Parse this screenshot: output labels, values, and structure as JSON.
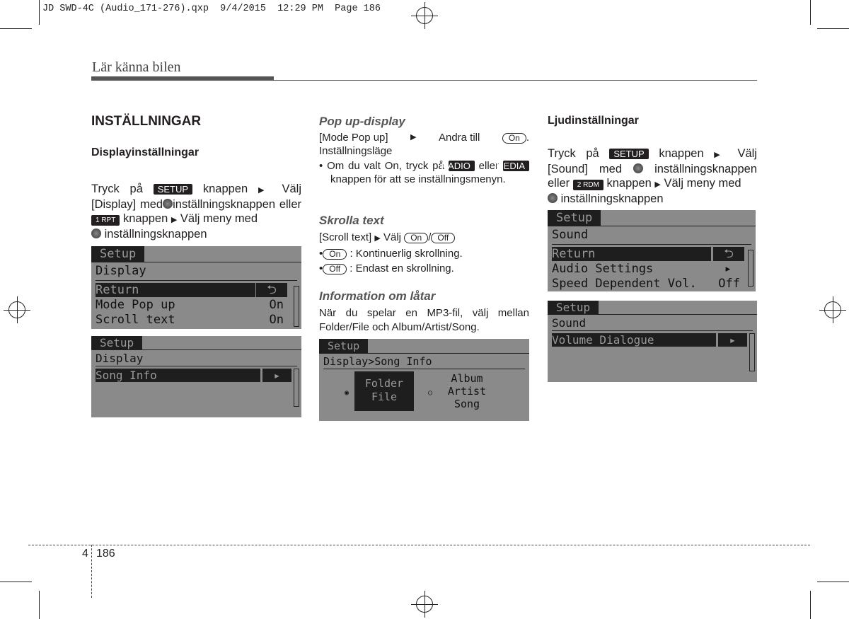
{
  "slug": "JD SWD-4C (Audio_171-276).qxp  9/4/2015  12:29 PM  Page 186",
  "chapter": "Lär känna bilen",
  "col1": {
    "title": "INSTÄLLNINGAR",
    "subtitle": "Displayinställningar",
    "t1": "Tryck på",
    "key_setup": "SETUP",
    "t2": "knappen",
    "t3": "Välj",
    "t4": "[Display] med",
    "t5": "inställningsknappen",
    "t6": "eller",
    "key_rpt": "1 RPT",
    "t7": "knappen",
    "t8": "Välj meny med",
    "t9": "inställningsknappen",
    "screen1": {
      "tab": "Setup",
      "header": "Display",
      "rows": [
        {
          "label": "Return",
          "value": "⮌"
        },
        {
          "label": "Mode Pop up",
          "value": "On"
        },
        {
          "label": "Scroll text",
          "value": "On"
        }
      ]
    },
    "screen2": {
      "tab": "Setup",
      "header": "Display",
      "rows": [
        {
          "label": "Song Info",
          "value": "▸"
        }
      ]
    }
  },
  "col2": {
    "popup_title": "Pop up-display",
    "popup_t1": "[Mode Pop up]",
    "popup_t2": "Andra till",
    "on": "On",
    "popup_t3": "Inställningsläge",
    "popup_b1": "Om du valt On, tryck på",
    "key_radio": "RADIO",
    "popup_b2": "eller",
    "key_media": "MEDIA",
    "popup_b3": "knappen för att se inställningsmenyn.",
    "scroll_title": "Skrolla text",
    "scroll_t1": "[Scroll text]",
    "scroll_t2": "Välj",
    "off": "Off",
    "scroll_b1": ": Kontinuerlig skrollning.",
    "scroll_b2": ": Endast en skrollning.",
    "info_title": "Information om låtar",
    "info_text": "När du spelar en MP3-fil, välj mellan Folder/File och Album/Artist/Song.",
    "screen": {
      "tab": "Setup",
      "header": "Display>Song Info",
      "opt1": [
        "Folder",
        "File"
      ],
      "opt2": [
        "Album",
        "Artist",
        "Song"
      ]
    }
  },
  "col3": {
    "title": "Ljudinställningar",
    "t1": "Tryck på",
    "key_setup": "SETUP",
    "t2": "knappen",
    "t3": "Välj",
    "t4": "[Sound] med",
    "t5": "inställningsknappen",
    "t6": "eller",
    "key_rdm": "2 RDM",
    "t7": "knappen",
    "t8": "Välj meny med",
    "t9": "inställningsknappen",
    "screen1": {
      "tab": "Setup",
      "header": "Sound",
      "rows": [
        {
          "label": "Return",
          "value": "⮌"
        },
        {
          "label": "Audio Settings",
          "value": "▸"
        },
        {
          "label": "Speed Dependent Vol.",
          "value": "Off"
        }
      ]
    },
    "screen2": {
      "tab": "Setup",
      "header": "Sound",
      "rows": [
        {
          "label": "Volume Dialogue",
          "value": "▸"
        }
      ]
    }
  },
  "footer": {
    "chapter_num": "4",
    "page_num": "186"
  }
}
